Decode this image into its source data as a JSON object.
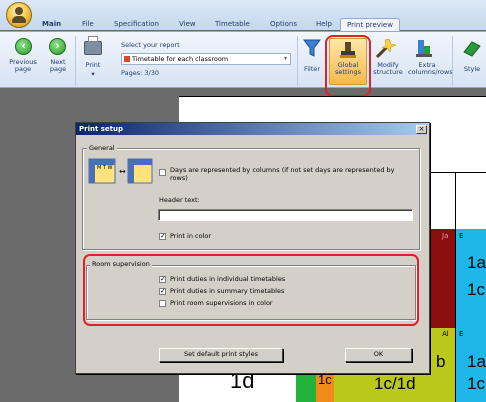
{
  "ribbon": {
    "tabs": [
      {
        "label": "Main"
      },
      {
        "label": "File"
      },
      {
        "label": "Specification"
      },
      {
        "label": "View"
      },
      {
        "label": "Timetable"
      },
      {
        "label": "Options"
      },
      {
        "label": "Help"
      },
      {
        "label": "Print preview"
      }
    ],
    "previous_page": "Previous page",
    "next_page": "Next page",
    "print": "Print",
    "select_report_label": "Select your report",
    "report_value": "Timetable for each classroom",
    "pages": "Pages: 3/30",
    "filter": "Filter",
    "global_settings": "Global settings",
    "modify_structure": "Modify structure",
    "extra_columns_rows": "Extra columns/rows",
    "style": "Style"
  },
  "preview": {
    "cells": [
      "Ja",
      "E",
      "1a",
      "1c",
      "Al",
      "E",
      "b",
      "1a",
      "1c",
      "1c/1d",
      "1c",
      "1d"
    ]
  },
  "dialog": {
    "title": "Print setup",
    "close": "×",
    "general": {
      "label": "General",
      "days_columns": "Days are represented by columns (if not set days are represented by rows)",
      "header_text_label": "Header text:",
      "header_text_value": "",
      "print_in_color": "Print in color"
    },
    "room": {
      "label": "Room supervision",
      "individual": "Print duties in individual timetables",
      "summary": "Print duties in summary timetables",
      "color": "Print room supervisions in color"
    },
    "default_button": "Set default print styles",
    "ok_button": "OK"
  },
  "colors": {
    "highlight": "#e2202a",
    "title_bar": "#0a246a",
    "dialog_bg": "#d4d0c8"
  }
}
